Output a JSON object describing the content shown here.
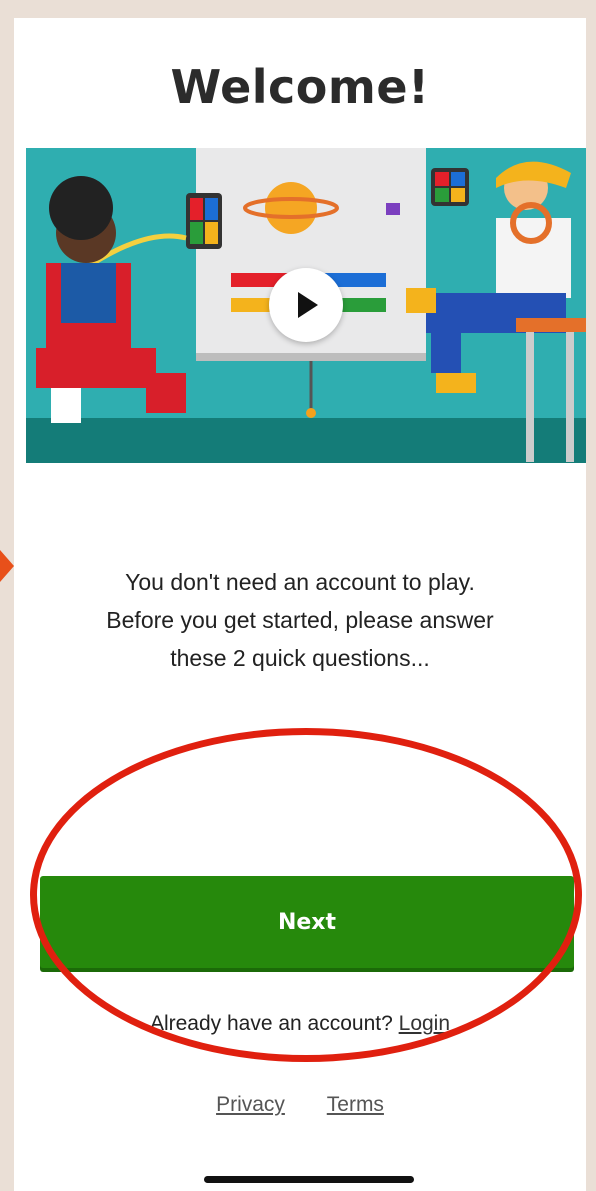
{
  "title": "Welcome!",
  "intro": {
    "line1": "You don't need an account to play.",
    "line2": "Before you get started, please answer",
    "line3": "these 2 quick questions..."
  },
  "next_button": {
    "label": "Next"
  },
  "login": {
    "prompt": "Already have an account?",
    "link": "Login"
  },
  "footer": {
    "privacy": "Privacy",
    "terms": "Terms"
  },
  "video_thumbnail": {
    "play_icon": "play-icon"
  },
  "colors": {
    "primary_green": "#26890c",
    "annotation_red": "#e0200f",
    "video_background": "#2faeb0"
  }
}
